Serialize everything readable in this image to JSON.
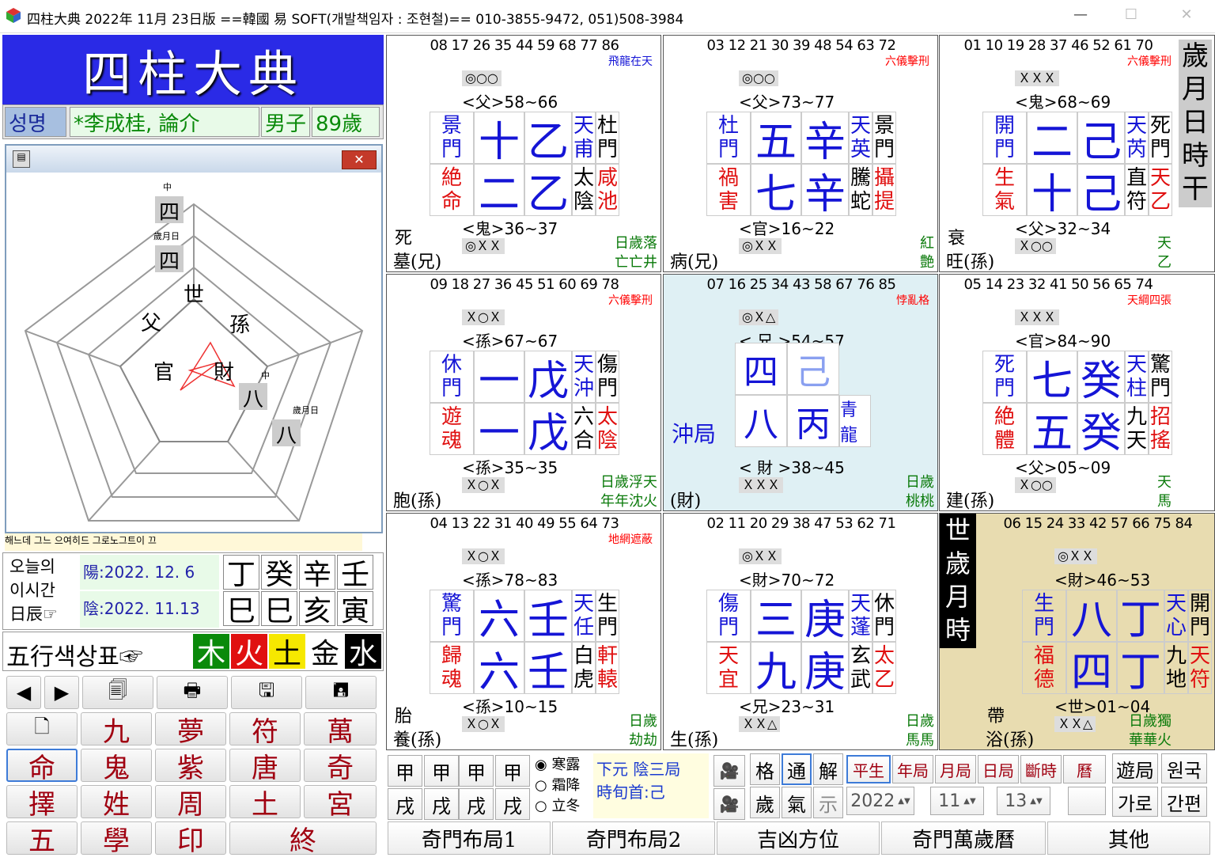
{
  "window": {
    "title": "四柱大典 2022年 11月 23日版 ==韓國 易 SOFT(개발책임자 : 조현철)== 010-3855-9472, 051)508-3984"
  },
  "logo": "四柱大典",
  "name": {
    "label": "성명",
    "value": "*李成桂, 論介",
    "sex": "男子",
    "age": "89歲"
  },
  "diagram": {
    "labels": [
      "世",
      "孫",
      "財",
      "官",
      "父"
    ],
    "top_small": "中",
    "top_big": "四",
    "mid_small": "歲月日",
    "mid_big": "四",
    "r_small": "中",
    "r_big": "八",
    "r2_small": "歲月日",
    "r2_big": "八"
  },
  "strip_text": "해느데 그느 으여히드 그로노그트이 끄",
  "today": {
    "label": [
      "오늘의",
      "이시간",
      "日辰☞"
    ],
    "yang": "陽:2022.  12. 6",
    "yin": "陰:2022.  11.13",
    "top": [
      "丁",
      "癸",
      "辛",
      "壬"
    ],
    "bot": [
      "巳",
      "巳",
      "亥",
      "寅"
    ]
  },
  "wuxing": {
    "label": "五行색상표☞",
    "elems": [
      "木",
      "火",
      "土",
      "金",
      "水"
    ]
  },
  "buttons": {
    "nav": [
      "◀",
      "▶",
      "🗐",
      "🖶",
      "🖫",
      "🖪"
    ],
    "row1": [
      "🗋",
      "九",
      "夢",
      "符",
      "萬"
    ],
    "row2": [
      "命",
      "鬼",
      "紫",
      "唐",
      "奇"
    ],
    "row3": [
      "擇",
      "姓",
      "周",
      "土",
      "宮"
    ],
    "row4": [
      "五",
      "學",
      "印",
      "終"
    ]
  },
  "charts": [
    {
      "nums": "08 17 26 35 44 59 68 77 86",
      "ann1": "飛龍在天",
      "box1": "◎○○",
      "rel1": "<父>58~66",
      "g": [
        [
          "景",
          "門"
        ],
        "十",
        "乙",
        [
          "天",
          "甫"
        ],
        [
          "杜",
          "門"
        ],
        [
          "絶",
          "命"
        ],
        "二",
        "乙",
        [
          "太",
          "陰"
        ],
        [
          "咸",
          "池"
        ]
      ],
      "rel2": "<鬼>36~37",
      "box2": "◎ＸＸ",
      "bl1": "死",
      "bl2": "墓(兄)",
      "br1": "日歲落",
      "br2": "亡亡井"
    },
    {
      "nums": "03 12 21 30 39 48 54 63 72",
      "ann1": "六儀擊刑",
      "box1": "◎○○",
      "rel1": "<父>73~77",
      "g": [
        [
          "杜",
          "門"
        ],
        "五",
        "辛",
        [
          "天",
          "英"
        ],
        [
          "景",
          "門"
        ],
        [
          "禍",
          "害"
        ],
        "七",
        "辛",
        [
          "騰",
          "蛇"
        ],
        [
          "攝",
          "提"
        ]
      ],
      "rel2": "<官>16~22",
      "box2": "◎ＸＸ",
      "bl1": "",
      "bl2": "病(兄)",
      "br1": "紅",
      "br2": "艶"
    },
    {
      "nums": "01 10 19 28 37 46 52 61 70",
      "ann1": "六儀擊刑",
      "box1": "ＸＸＸ",
      "rel1": "<鬼>68~69",
      "g": [
        [
          "開",
          "門"
        ],
        "二",
        "己",
        [
          "天",
          "芮"
        ],
        [
          "死",
          "門"
        ],
        [
          "生",
          "氣"
        ],
        "十",
        "己",
        [
          "直",
          "符"
        ],
        [
          "天",
          "乙"
        ]
      ],
      "rel2": "<父>32~34",
      "box2": "Ｘ○○",
      "bl1": "衰",
      "bl2": "旺(孫)",
      "br1": "天",
      "br2": "乙"
    },
    {
      "nums": "09 18 27 36 45 51 60 69 78",
      "ann1": "六儀擊刑",
      "box1": "Ｘ○Ｘ",
      "rel1": "<孫>67~67",
      "g": [
        [
          "休",
          "門"
        ],
        "一",
        "戊",
        [
          "天",
          "沖"
        ],
        [
          "傷",
          "門"
        ],
        [
          "遊",
          "魂"
        ],
        "一",
        "戊",
        [
          "六",
          "合"
        ],
        [
          "太",
          "陰"
        ]
      ],
      "rel2": "<孫>35~35",
      "box2": "Ｘ○Ｘ",
      "bl1": "",
      "bl2": "胞(孫)",
      "br1": "日歲浮天",
      "br2": "年年沈火"
    },
    {
      "nums": "07 16 25 34 43 58 67 76 85",
      "ann1": "悖亂格",
      "box1": "◎Ｘ△",
      "rel1": "< 兄 >54~57",
      "g": [
        "四",
        "己",
        "八",
        "丙",
        "青龍"
      ],
      "rel2": "< 財 >38~45",
      "box2": "ＸＸＸ",
      "bl1": "沖局",
      "bl2": "(財)",
      "br1": "日歲",
      "br2": "桃桃"
    },
    {
      "nums": "05 14 23 32 41 50 56 65 74",
      "ann1": "天綱四張",
      "box1": "ＸＸＸ",
      "rel1": "<官>84~90",
      "g": [
        [
          "死",
          "門"
        ],
        "七",
        "癸",
        [
          "天",
          "柱"
        ],
        [
          "驚",
          "門"
        ],
        [
          "絶",
          "體"
        ],
        "五",
        "癸",
        [
          "九",
          "天"
        ],
        [
          "招",
          "搖"
        ]
      ],
      "rel2": "<父>05~09",
      "box2": "Ｘ○○",
      "bl1": "",
      "bl2": "建(孫)",
      "br1": "天",
      "br2": "馬"
    },
    {
      "nums": "04 13 22 31 40 49 55 64 73",
      "ann1": "地網遮蔽",
      "box1": "Ｘ○Ｘ",
      "rel1": "<孫>78~83",
      "g": [
        [
          "驚",
          "門"
        ],
        "六",
        "壬",
        [
          "天",
          "任"
        ],
        [
          "生",
          "門"
        ],
        [
          "歸",
          "魂"
        ],
        "六",
        "壬",
        [
          "白",
          "虎"
        ],
        [
          "軒",
          "轅"
        ]
      ],
      "rel2": "<孫>10~15",
      "box2": "Ｘ○Ｘ",
      "bl1": "胎",
      "bl2": "養(孫)",
      "br1": "日歲",
      "br2": "劫劫"
    },
    {
      "nums": "02 11 20 29 38 47 53 62 71",
      "ann1": "",
      "box1": "◎ＸＸ",
      "rel1": "<財>70~72",
      "g": [
        [
          "傷",
          "門"
        ],
        "三",
        "庚",
        [
          "天",
          "蓬"
        ],
        [
          "休",
          "門"
        ],
        [
          "天",
          "宜"
        ],
        "九",
        "庚",
        [
          "玄",
          "武"
        ],
        [
          "太",
          "乙"
        ]
      ],
      "rel2": "<兄>23~31",
      "box2": "ＸＸ△",
      "bl1": "",
      "bl2": "生(孫)",
      "br1": "日歲",
      "br2": "馬馬"
    },
    {
      "nums": "06 15 24 33 42 57 66 75 84",
      "ann1": "",
      "box1": "◎ＸＸ",
      "rel1": "<財>46~53",
      "g": [
        [
          "生",
          "門"
        ],
        "八",
        "丁",
        [
          "天",
          "心"
        ],
        [
          "開",
          "門"
        ],
        [
          "福",
          "德"
        ],
        "四",
        "丁",
        [
          "九",
          "地"
        ],
        [
          "天",
          "符"
        ]
      ],
      "rel2": "<世>01~04",
      "box2": "ＸＸ△",
      "bl1": "帶",
      "bl2": "浴(孫)",
      "br1": "日歲獨",
      "br2": "華華火"
    }
  ],
  "side_label": [
    "歲",
    "月",
    "日",
    "時",
    "干"
  ],
  "sel_label": [
    "世",
    "歲",
    "月",
    "時"
  ],
  "controls": {
    "gz_top": [
      "甲",
      "甲",
      "甲",
      "甲"
    ],
    "gz_bot": [
      "戌",
      "戌",
      "戌",
      "戌"
    ],
    "radios": [
      "寒露",
      "霜降",
      "立冬"
    ],
    "info1": "下元  陰三局",
    "info2": "時旬首:己",
    "opts1": [
      "格",
      "通",
      "解"
    ],
    "opts2": [
      "歲",
      "氣",
      "示"
    ],
    "modes": [
      "平生",
      "年局",
      "月局",
      "日局",
      "斷時",
      "曆"
    ],
    "extra": [
      "遊局",
      "원국",
      "가로",
      "간편"
    ],
    "year": "2022",
    "month": "11",
    "day": "13"
  },
  "tabs": [
    "奇門布局1",
    "奇門布局2",
    "吉凶方位",
    "奇門萬歲曆",
    "其他"
  ]
}
